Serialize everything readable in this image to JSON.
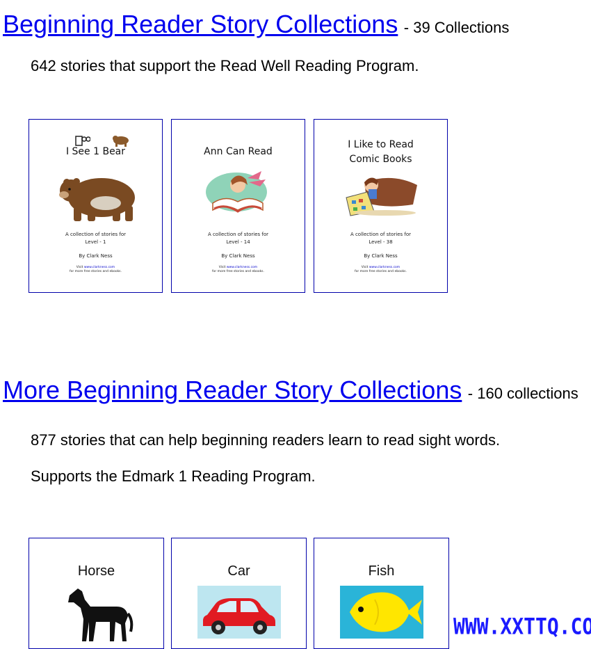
{
  "section1": {
    "heading": "Beginning Reader Story Collections",
    "count": "- 39 Collections",
    "description": "642 stories that support the Read Well Reading Program.",
    "cards": [
      {
        "title": "I  See  1  Bear",
        "subtitle": "A collection of stories for",
        "level": "Level - 1",
        "author": "By Clark Ness",
        "visit_a": "Visit ",
        "visit_link": "www.clarkness.com",
        "visit_b": "for more free stories and ebooks."
      },
      {
        "title": "Ann Can Read",
        "subtitle": "A collection of stories for",
        "level": "Level - 14",
        "author": "By Clark Ness",
        "visit_a": "Visit ",
        "visit_link": "www.clarkness.com",
        "visit_b": "for more free stories and ebooks."
      },
      {
        "title_line1": "I Like to Read",
        "title_line2": "Comic Books",
        "subtitle": "A collection of stories for",
        "level": "Level - 38",
        "author": "By Clark Ness",
        "visit_a": "Visit ",
        "visit_link": "www.clarkness.com",
        "visit_b": "for more free stories and ebooks."
      }
    ]
  },
  "section2": {
    "heading": "More Beginning Reader Story Collections",
    "count": "- 160 collections",
    "description1": "877 stories that can help beginning readers learn to read sight words.",
    "description2": "Supports the Edmark 1 Reading Program.",
    "cards": [
      {
        "title": "Horse"
      },
      {
        "title": "Car"
      },
      {
        "title": "Fish"
      }
    ]
  },
  "watermark": "WWW.XXTTQ.COM",
  "colors": {
    "link": "#0000ee",
    "card_border": "#0000aa",
    "watermark": "#1a1aff"
  }
}
